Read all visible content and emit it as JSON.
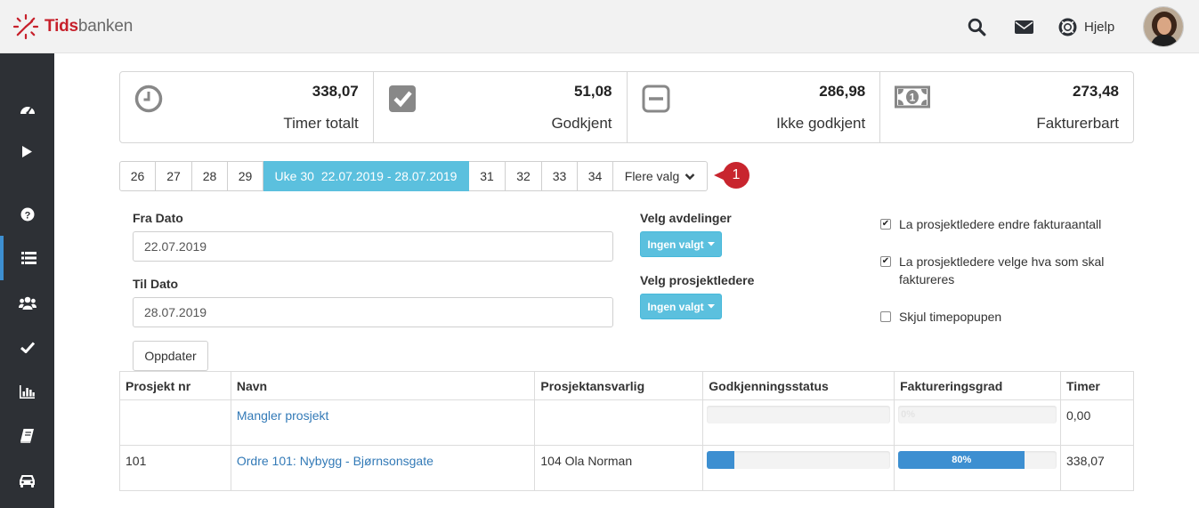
{
  "app": {
    "brand_a": "Tids",
    "brand_b": "banken"
  },
  "header": {
    "help_label": "Hjelp",
    "icons": [
      "search-icon",
      "envelope-icon",
      "lifebuoy-icon"
    ]
  },
  "sidebar": {
    "items": [
      "dashboard-icon",
      "play-icon",
      "question-icon",
      "list-icon",
      "users-icon",
      "check-icon",
      "bar-chart-icon",
      "book-icon",
      "car-icon"
    ],
    "active_index": 3
  },
  "stats": [
    {
      "icon": "clock-icon",
      "value": "338,07",
      "label": "Timer totalt"
    },
    {
      "icon": "checkbox-icon",
      "value": "51,08",
      "label": "Godkjent"
    },
    {
      "icon": "minus-square-icon",
      "value": "286,98",
      "label": "Ikke godkjent"
    },
    {
      "icon": "money-icon",
      "value": "273,48",
      "label": "Fakturerbart"
    }
  ],
  "weeks": {
    "before": [
      "26",
      "27",
      "28",
      "29"
    ],
    "active_label": "Uke 30",
    "active_dates": "22.07.2019 - 28.07.2019",
    "after": [
      "31",
      "32",
      "33",
      "34"
    ],
    "more_label": "Flere valg",
    "badge": "1"
  },
  "form": {
    "from_label": "Fra Dato",
    "from_value": "22.07.2019",
    "to_label": "Til Dato",
    "to_value": "28.07.2019",
    "update_label": "Oppdater",
    "departments_label": "Velg avdelinger",
    "departments_value": "Ingen valgt",
    "managers_label": "Velg prosjektledere",
    "managers_value": "Ingen valgt"
  },
  "options": [
    {
      "label": "La prosjektledere endre fakturaantall",
      "checked": true
    },
    {
      "label": "La prosjektledere velge hva som skal faktureres",
      "checked": true
    },
    {
      "label": "Skjul timepopupen",
      "checked": false
    }
  ],
  "table": {
    "headers": [
      "Prosjekt nr",
      "Navn",
      "Prosjektansvarlig",
      "Godkjenningsstatus",
      "Faktureringsgrad",
      "Timer"
    ],
    "rows": [
      {
        "nr": "",
        "name": "Mangler prosjekt",
        "manager": "",
        "approval": 0,
        "billing": 0,
        "billing_label": "0%",
        "hours": "0,00"
      },
      {
        "nr": "101",
        "name": "Ordre 101: Nybygg - Bjørnsonsgate",
        "manager": "104 Ola Norman",
        "approval": 0.15,
        "billing": 0.8,
        "billing_label": "80%",
        "hours": "338,07"
      }
    ]
  },
  "colors": {
    "accent": "#5bc0de",
    "progress": "#3d8fd1",
    "sidebar": "#2d3035",
    "badge": "#c8252e",
    "brand": "#c7202b"
  }
}
